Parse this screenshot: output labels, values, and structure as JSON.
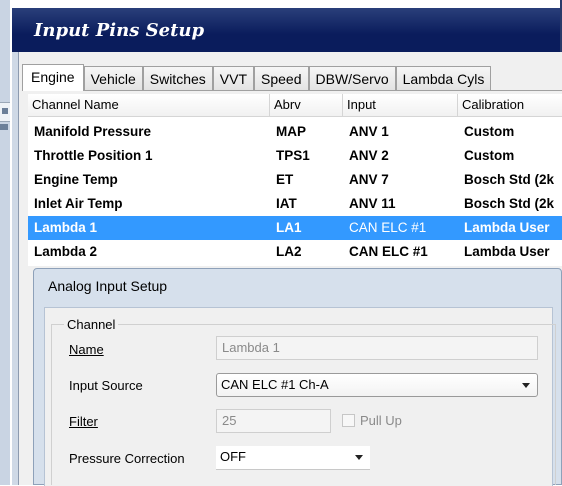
{
  "window": {
    "title": "Input Pins Setup"
  },
  "tabs": [
    "Engine",
    "Vehicle",
    "Switches",
    "VVT",
    "Speed",
    "DBW/Servo",
    "Lambda Cyls"
  ],
  "active_tab": "Engine",
  "table": {
    "columns": [
      "Channel Name",
      "Abrv",
      "Input",
      "Calibration"
    ],
    "rows": [
      [
        "Manifold Pressure",
        "MAP",
        "ANV 1",
        "Custom"
      ],
      [
        "Throttle Position 1",
        "TPS1",
        "ANV 2",
        "Custom"
      ],
      [
        "Engine Temp",
        "ET",
        "ANV 7",
        "Bosch Std (2k"
      ],
      [
        "Inlet Air Temp",
        "IAT",
        "ANV 11",
        "Bosch Std (2k"
      ],
      [
        "Lambda 1",
        "LA1",
        "CAN ELC #1",
        "Lambda User"
      ],
      [
        "Lambda 2",
        "LA2",
        "CAN ELC #1",
        "Lambda User"
      ]
    ],
    "selected_row": 4
  },
  "dialog": {
    "title": "Analog Input Setup",
    "group_label": "Channel",
    "name_label": "Name",
    "name_value": "Lambda 1",
    "input_source_label": "Input Source",
    "input_source_value": "CAN ELC #1 Ch-A",
    "filter_label": "Filter",
    "filter_value": "25",
    "pull_up_label": "Pull Up",
    "pressure_correction_label": "Pressure Correction",
    "pressure_correction_value": "OFF"
  },
  "colors": {
    "titlebar": "#0a1c5c",
    "selection": "#3399ff"
  }
}
